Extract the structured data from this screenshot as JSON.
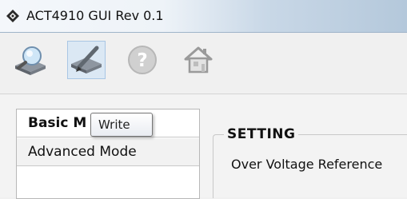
{
  "window": {
    "title": "ACT4910 GUI Rev 0.1"
  },
  "toolbar": {
    "tools": [
      {
        "icon": "read-chip-icon",
        "selected": false
      },
      {
        "icon": "write-chip-icon",
        "selected": true
      },
      {
        "icon": "help-icon",
        "selected": false
      },
      {
        "icon": "home-icon",
        "selected": false
      }
    ]
  },
  "tooltip": {
    "text": "Write"
  },
  "tabs": [
    {
      "label": "Basic Mode",
      "visible_label": "Basic M",
      "active": true
    },
    {
      "label": "Advanced Mode",
      "active": false
    }
  ],
  "setting": {
    "group_title": "SETTING",
    "first_field_label": "Over Voltage Reference"
  }
}
